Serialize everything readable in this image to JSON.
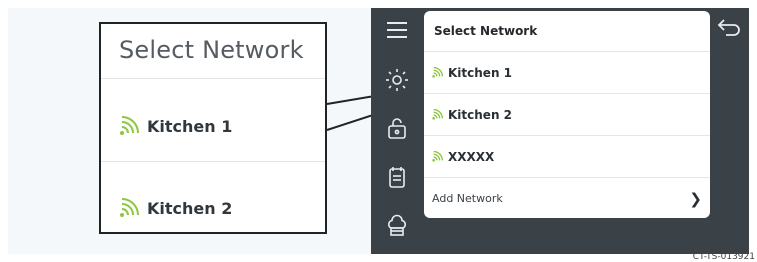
{
  "callout": {
    "title": "Select Network",
    "networks": [
      {
        "label": "Kitchen 1",
        "icon": "wifi-icon"
      },
      {
        "label": "Kitchen 2",
        "icon": "wifi-icon"
      }
    ]
  },
  "device": {
    "rail_icons": [
      "menu-icon",
      "sun-icon",
      "lock-icon",
      "recipe-book-icon",
      "chef-hat-icon"
    ],
    "back_icon": "back-arrow-icon",
    "panel": {
      "title": "Select Network",
      "networks": [
        {
          "label": "Kitchen 1",
          "icon": "wifi-icon"
        },
        {
          "label": "Kitchen 2",
          "icon": "wifi-icon"
        },
        {
          "label": "XXXXX",
          "icon": "wifi-icon"
        }
      ],
      "add_network": "Add Network",
      "add_icon": "chevron-right-icon"
    }
  },
  "figure_code": "CT-TS-013921",
  "colors": {
    "wifi_green": "#8dc63f",
    "rail": "#3a4147"
  }
}
